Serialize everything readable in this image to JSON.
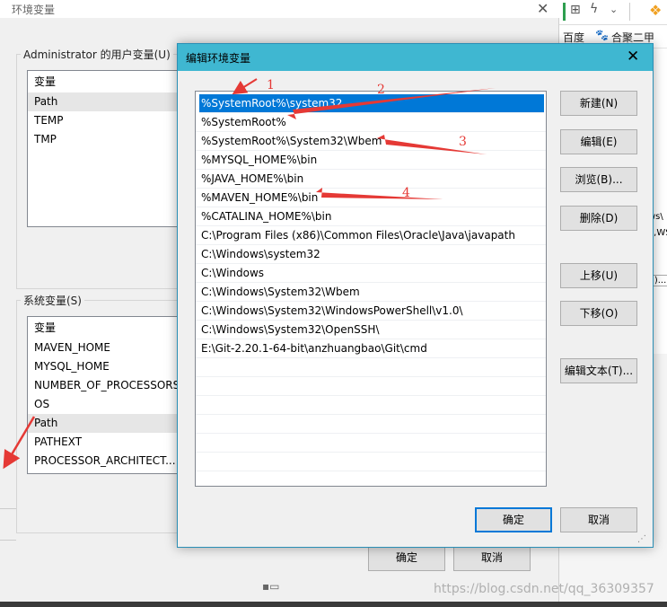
{
  "bg_window": {
    "title": "环境变量",
    "user_vars_label": "Administrator 的用户变量(U)",
    "user_vars_header": "变量",
    "user_vars": [
      "Path",
      "TEMP",
      "TMP"
    ],
    "system_vars_label": "系统变量(S)",
    "system_vars_header": "变量",
    "system_vars": [
      "MAVEN_HOME",
      "MYSQL_HOME",
      "NUMBER_OF_PROCESSORS",
      "OS",
      "Path",
      "PATHEXT",
      "PROCESSOR_ARCHITECT..."
    ],
    "ok_label": "确定",
    "cancel_label": "取消"
  },
  "right_app": {
    "bookmark_baidu": "百度",
    "bookmark_2": "合聚二甲",
    "snippet_1": "ws\\",
    "snippet_2": "ě,WS",
    "snippet_3": "(I)...",
    "snippet_4": "ě"
  },
  "dialog": {
    "title": "编辑环境变量",
    "paths": [
      "%SystemRoot%\\system32",
      "%SystemRoot%",
      "%SystemRoot%\\System32\\Wbem",
      "%MYSQL_HOME%\\bin",
      "%JAVA_HOME%\\bin",
      "%MAVEN_HOME%\\bin",
      "%CATALINA_HOME%\\bin",
      "C:\\Program Files (x86)\\Common Files\\Oracle\\Java\\javapath",
      "C:\\Windows\\system32",
      "C:\\Windows",
      "C:\\Windows\\System32\\Wbem",
      "C:\\Windows\\System32\\WindowsPowerShell\\v1.0\\",
      "C:\\Windows\\System32\\OpenSSH\\",
      "E:\\Git-2.20.1-64-bit\\anzhuangbao\\Git\\cmd"
    ],
    "buttons": {
      "new": "新建(N)",
      "edit": "编辑(E)",
      "browse": "浏览(B)...",
      "delete": "删除(D)",
      "move_up": "上移(U)",
      "move_down": "下移(O)",
      "edit_text": "编辑文本(T)..."
    },
    "ok_label": "确定",
    "cancel_label": "取消"
  },
  "annotations": [
    "1",
    "2",
    "3",
    "4"
  ],
  "watermark": "https://blog.csdn.net/qq_36309357",
  "colors": {
    "dialog_titlebar": "#3fb7d1",
    "selection": "#0078d7",
    "annotation": "#e53935"
  }
}
